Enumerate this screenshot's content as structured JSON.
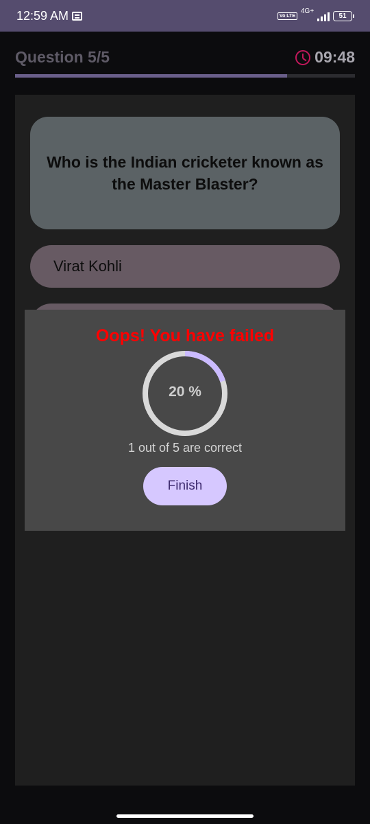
{
  "status_bar": {
    "time": "12:59 AM",
    "volte": "Vo LTE",
    "network": "4G+",
    "battery": "51"
  },
  "header": {
    "question_counter": "Question 5/5",
    "timer": "09:48",
    "progress_fraction": 0.8,
    "progress_color": "#6a5f8a"
  },
  "question": {
    "text": "Who is the Indian cricketer known as the Master Blaster?"
  },
  "options": [
    {
      "label": "Virat Kohli"
    },
    {
      "label": ""
    }
  ],
  "result": {
    "title": "Oops! You have failed",
    "score_percent_text": "20 %",
    "score_fraction": 0.2,
    "summary": "1 out of 5 are correct",
    "finish_label": "Finish",
    "title_color": "#ff0000",
    "ring_track_color": "#d9d9d9",
    "ring_progress_color": "#cbbbff"
  },
  "icons": {
    "notification": "notification-icon",
    "timer": "clock-icon"
  }
}
